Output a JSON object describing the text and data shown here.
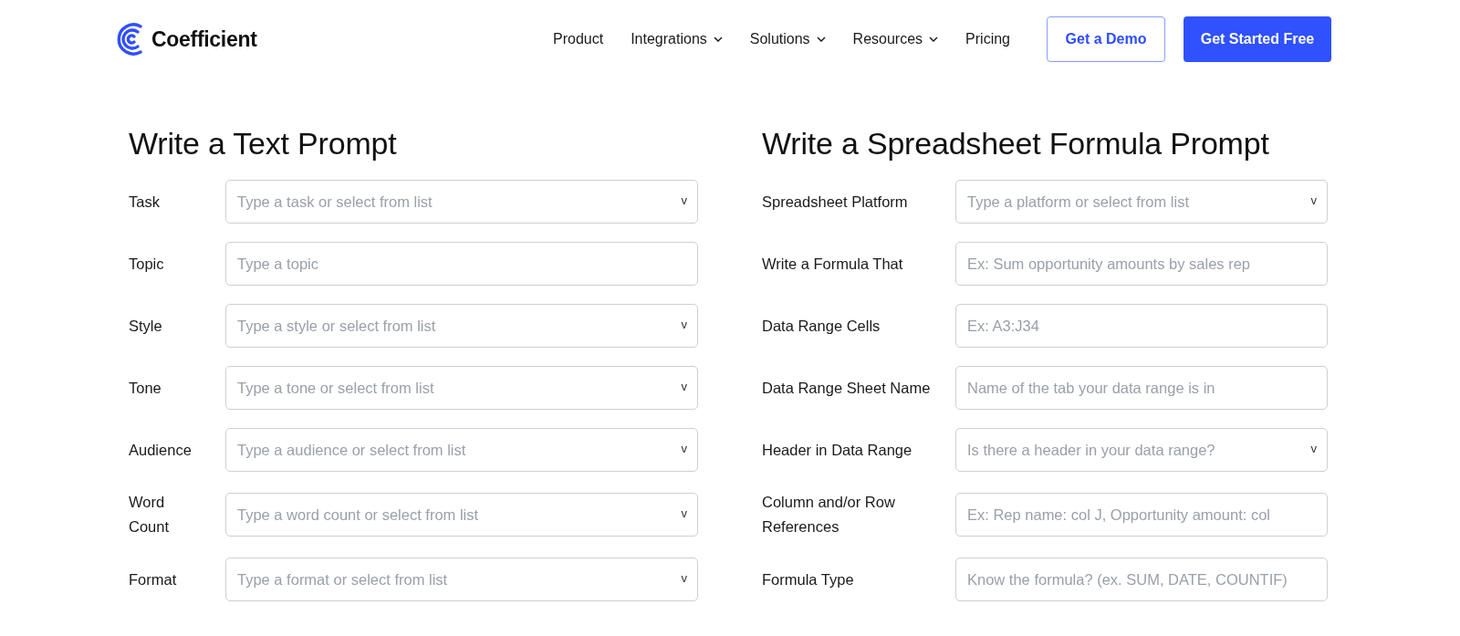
{
  "header": {
    "logo_text": "Coefficient",
    "nav": [
      {
        "label": "Product",
        "has_menu": false
      },
      {
        "label": "Integrations",
        "has_menu": true
      },
      {
        "label": "Solutions",
        "has_menu": true
      },
      {
        "label": "Resources",
        "has_menu": true
      },
      {
        "label": "Pricing",
        "has_menu": false
      }
    ],
    "buttons": [
      {
        "label": "Get a Demo",
        "kind": "outline"
      },
      {
        "label": "Get Started Free",
        "kind": "primary"
      }
    ]
  },
  "sections": [
    {
      "title": "Write a Text Prompt",
      "fields": [
        {
          "label": "Task",
          "kind": "select",
          "placeholder": "Type a task or select from list",
          "caret": "v"
        },
        {
          "label": "Topic",
          "kind": "text",
          "placeholder": "Type a topic"
        },
        {
          "label": "Style",
          "kind": "select",
          "placeholder": "Type a style or select from list",
          "caret": "v"
        },
        {
          "label": "Tone",
          "kind": "select",
          "placeholder": "Type a tone or select from list",
          "caret": "v"
        },
        {
          "label": "Audience",
          "kind": "select",
          "placeholder": "Type a audience or select from list",
          "caret": "v"
        },
        {
          "label": "Word Count",
          "kind": "select",
          "placeholder": "Type a word count or select from list",
          "caret": "v"
        },
        {
          "label": "Format",
          "kind": "select",
          "placeholder": "Type a format or select from list",
          "caret": "v"
        }
      ]
    },
    {
      "title": "Write a Spreadsheet Formula Prompt",
      "fields": [
        {
          "label": "Spreadsheet Platform",
          "kind": "select",
          "placeholder": "Type a platform or select from list",
          "caret": "v"
        },
        {
          "label": "Write a Formula That",
          "kind": "text",
          "placeholder": "Ex: Sum opportunity amounts by sales rep"
        },
        {
          "label": "Data Range Cells",
          "kind": "text",
          "placeholder": "Ex: A3:J34"
        },
        {
          "label": "Data Range Sheet Name",
          "kind": "text",
          "placeholder": "Name of the tab your data range is in"
        },
        {
          "label": "Header in Data Range",
          "kind": "select",
          "placeholder": "Is there a header in your data range?",
          "caret": "v"
        },
        {
          "label": "Column and/or Row References",
          "kind": "text",
          "placeholder": "Ex: Rep name: col J, Opportunity amount: col"
        },
        {
          "label": "Formula Type",
          "kind": "text",
          "placeholder": "Know the formula? (ex. SUM, DATE, COUNTIF)"
        }
      ]
    }
  ]
}
